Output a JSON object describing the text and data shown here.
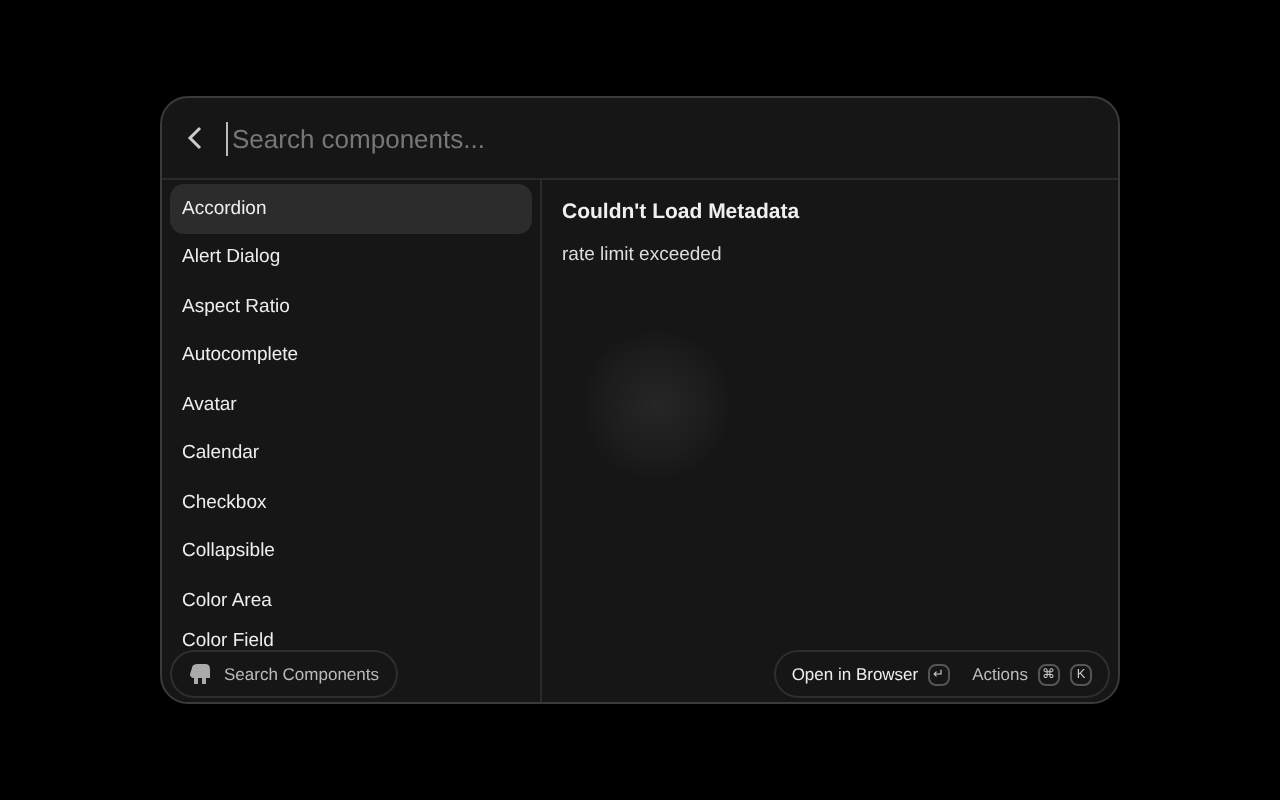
{
  "search": {
    "placeholder": "Search components..."
  },
  "items": [
    {
      "label": "Accordion",
      "selected": true
    },
    {
      "label": "Alert Dialog",
      "selected": false
    },
    {
      "label": "Aspect Ratio",
      "selected": false
    },
    {
      "label": "Autocomplete",
      "selected": false
    },
    {
      "label": "Avatar",
      "selected": false
    },
    {
      "label": "Calendar",
      "selected": false
    },
    {
      "label": "Checkbox",
      "selected": false
    },
    {
      "label": "Collapsible",
      "selected": false
    },
    {
      "label": "Color Area",
      "selected": false
    },
    {
      "label": "Color Field",
      "selected": false
    }
  ],
  "detail": {
    "title": "Couldn't Load Metadata",
    "message": "rate limit exceeded"
  },
  "footer": {
    "command": "Search Components",
    "primary_action": "Open in Browser",
    "primary_key": "↵",
    "actions": "Actions",
    "action_keys": [
      "⌘",
      "K"
    ]
  }
}
